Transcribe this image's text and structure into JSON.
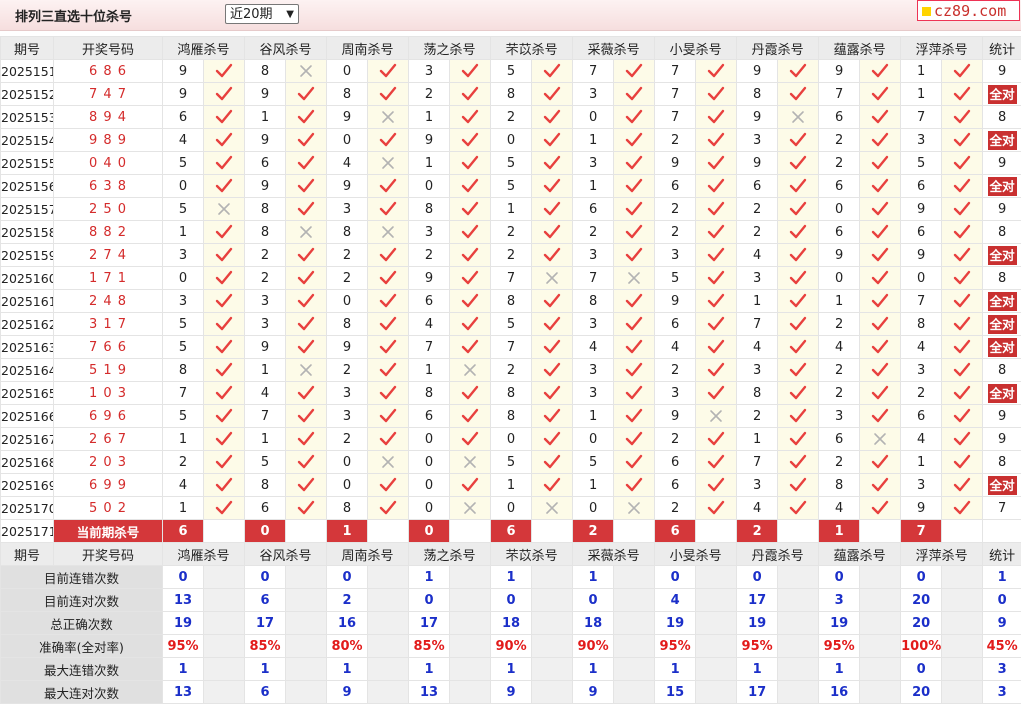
{
  "header": {
    "title": "排列三直选十位杀号",
    "period_select": "近20期",
    "site_logo": "cz89.com"
  },
  "columns": {
    "issue": "期号",
    "win": "开奖号码",
    "experts": [
      "鸿雁杀号",
      "谷风杀号",
      "周南杀号",
      "荡之杀号",
      "芣苡杀号",
      "采薇杀号",
      "小旻杀号",
      "丹霞杀号",
      "蕴露杀号",
      "浮萍杀号"
    ],
    "stat": "统计"
  },
  "rows": [
    {
      "issue": "2025151",
      "win": "6 8 6",
      "k": [
        9,
        8,
        0,
        3,
        5,
        7,
        7,
        9,
        9,
        1
      ],
      "ok": [
        1,
        0,
        1,
        1,
        1,
        1,
        1,
        1,
        1,
        1
      ],
      "stat": "9"
    },
    {
      "issue": "2025152",
      "win": "7 4 7",
      "k": [
        9,
        9,
        8,
        2,
        8,
        3,
        7,
        8,
        7,
        1
      ],
      "ok": [
        1,
        1,
        1,
        1,
        1,
        1,
        1,
        1,
        1,
        1
      ],
      "stat": "全对"
    },
    {
      "issue": "2025153",
      "win": "8 9 4",
      "k": [
        6,
        1,
        9,
        1,
        2,
        0,
        7,
        9,
        6,
        7
      ],
      "ok": [
        1,
        1,
        0,
        1,
        1,
        1,
        1,
        0,
        1,
        1
      ],
      "stat": "8"
    },
    {
      "issue": "2025154",
      "win": "9 8 9",
      "k": [
        4,
        9,
        0,
        9,
        0,
        1,
        2,
        3,
        2,
        3
      ],
      "ok": [
        1,
        1,
        1,
        1,
        1,
        1,
        1,
        1,
        1,
        1
      ],
      "stat": "全对"
    },
    {
      "issue": "2025155",
      "win": "0 4 0",
      "k": [
        5,
        6,
        4,
        1,
        5,
        3,
        9,
        9,
        2,
        5
      ],
      "ok": [
        1,
        1,
        0,
        1,
        1,
        1,
        1,
        1,
        1,
        1
      ],
      "stat": "9"
    },
    {
      "issue": "2025156",
      "win": "6 3 8",
      "k": [
        0,
        9,
        9,
        0,
        5,
        1,
        6,
        6,
        6,
        6
      ],
      "ok": [
        1,
        1,
        1,
        1,
        1,
        1,
        1,
        1,
        1,
        1
      ],
      "stat": "全对"
    },
    {
      "issue": "2025157",
      "win": "2 5 0",
      "k": [
        5,
        8,
        3,
        8,
        1,
        6,
        2,
        2,
        0,
        9
      ],
      "ok": [
        0,
        1,
        1,
        1,
        1,
        1,
        1,
        1,
        1,
        1
      ],
      "stat": "9"
    },
    {
      "issue": "2025158",
      "win": "8 8 2",
      "k": [
        1,
        8,
        8,
        3,
        2,
        2,
        2,
        2,
        6,
        6
      ],
      "ok": [
        1,
        0,
        0,
        1,
        1,
        1,
        1,
        1,
        1,
        1
      ],
      "stat": "8"
    },
    {
      "issue": "2025159",
      "win": "2 7 4",
      "k": [
        3,
        2,
        2,
        2,
        2,
        3,
        3,
        4,
        9,
        9
      ],
      "ok": [
        1,
        1,
        1,
        1,
        1,
        1,
        1,
        1,
        1,
        1
      ],
      "stat": "全对"
    },
    {
      "issue": "2025160",
      "win": "1 7 1",
      "k": [
        0,
        2,
        2,
        9,
        7,
        7,
        5,
        3,
        0,
        0
      ],
      "ok": [
        1,
        1,
        1,
        1,
        0,
        0,
        1,
        1,
        1,
        1
      ],
      "stat": "8"
    },
    {
      "issue": "2025161",
      "win": "2 4 8",
      "k": [
        3,
        3,
        0,
        6,
        8,
        8,
        9,
        1,
        1,
        7
      ],
      "ok": [
        1,
        1,
        1,
        1,
        1,
        1,
        1,
        1,
        1,
        1
      ],
      "stat": "全对"
    },
    {
      "issue": "2025162",
      "win": "3 1 7",
      "k": [
        5,
        3,
        8,
        4,
        5,
        3,
        6,
        7,
        2,
        8
      ],
      "ok": [
        1,
        1,
        1,
        1,
        1,
        1,
        1,
        1,
        1,
        1
      ],
      "stat": "全对"
    },
    {
      "issue": "2025163",
      "win": "7 6 6",
      "k": [
        5,
        9,
        9,
        7,
        7,
        4,
        4,
        4,
        4,
        4
      ],
      "ok": [
        1,
        1,
        1,
        1,
        1,
        1,
        1,
        1,
        1,
        1
      ],
      "stat": "全对"
    },
    {
      "issue": "2025164",
      "win": "5 1 9",
      "k": [
        8,
        1,
        2,
        1,
        2,
        3,
        2,
        3,
        2,
        3
      ],
      "ok": [
        1,
        0,
        1,
        0,
        1,
        1,
        1,
        1,
        1,
        1
      ],
      "stat": "8"
    },
    {
      "issue": "2025165",
      "win": "1 0 3",
      "k": [
        7,
        4,
        3,
        8,
        8,
        3,
        3,
        8,
        2,
        2
      ],
      "ok": [
        1,
        1,
        1,
        1,
        1,
        1,
        1,
        1,
        1,
        1
      ],
      "stat": "全对"
    },
    {
      "issue": "2025166",
      "win": "6 9 6",
      "k": [
        5,
        7,
        3,
        6,
        8,
        1,
        9,
        2,
        3,
        6
      ],
      "ok": [
        1,
        1,
        1,
        1,
        1,
        1,
        0,
        1,
        1,
        1
      ],
      "stat": "9"
    },
    {
      "issue": "2025167",
      "win": "2 6 7",
      "k": [
        1,
        1,
        2,
        0,
        0,
        0,
        2,
        1,
        6,
        4
      ],
      "ok": [
        1,
        1,
        1,
        1,
        1,
        1,
        1,
        1,
        0,
        1
      ],
      "stat": "9"
    },
    {
      "issue": "2025168",
      "win": "2 0 3",
      "k": [
        2,
        5,
        0,
        0,
        5,
        5,
        6,
        7,
        2,
        1
      ],
      "ok": [
        1,
        1,
        0,
        0,
        1,
        1,
        1,
        1,
        1,
        1
      ],
      "stat": "8"
    },
    {
      "issue": "2025169",
      "win": "6 9 9",
      "k": [
        4,
        8,
        0,
        0,
        1,
        1,
        6,
        3,
        8,
        3
      ],
      "ok": [
        1,
        1,
        1,
        1,
        1,
        1,
        1,
        1,
        1,
        1
      ],
      "stat": "全对"
    },
    {
      "issue": "2025170",
      "win": "5 0 2",
      "k": [
        1,
        6,
        8,
        0,
        0,
        0,
        2,
        4,
        4,
        9
      ],
      "ok": [
        1,
        1,
        1,
        0,
        0,
        0,
        1,
        1,
        1,
        1
      ],
      "stat": "7"
    }
  ],
  "current": {
    "issue": "2025171",
    "label": "当前期杀号",
    "k": [
      6,
      0,
      1,
      0,
      6,
      2,
      6,
      2,
      1,
      7
    ]
  },
  "stats": [
    {
      "label": "目前连错次数",
      "v": [
        "0",
        "0",
        "0",
        "1",
        "1",
        "1",
        "0",
        "0",
        "0",
        "0"
      ],
      "stat": "1",
      "red": false
    },
    {
      "label": "目前连对次数",
      "v": [
        "13",
        "6",
        "2",
        "0",
        "0",
        "0",
        "4",
        "17",
        "3",
        "20"
      ],
      "stat": "0",
      "red": false
    },
    {
      "label": "总正确次数",
      "v": [
        "19",
        "17",
        "16",
        "17",
        "18",
        "18",
        "19",
        "19",
        "19",
        "20"
      ],
      "stat": "9",
      "red": false
    },
    {
      "label": "准确率(全对率)",
      "v": [
        "95%",
        "85%",
        "80%",
        "85%",
        "90%",
        "90%",
        "95%",
        "95%",
        "95%",
        "100%"
      ],
      "stat": "45%",
      "red": true
    },
    {
      "label": "最大连错次数",
      "v": [
        "1",
        "1",
        "1",
        "1",
        "1",
        "1",
        "1",
        "1",
        "1",
        "0"
      ],
      "stat": "3",
      "red": false
    },
    {
      "label": "最大连对次数",
      "v": [
        "13",
        "6",
        "9",
        "13",
        "9",
        "9",
        "15",
        "17",
        "16",
        "20"
      ],
      "stat": "3",
      "red": false
    }
  ],
  "colors": {
    "accent_red": "#d4373a",
    "check_red": "#e8403e",
    "cross_gray": "#b3b3b3",
    "stat_blue": "#1b2fc9"
  },
  "icons": {
    "ok": "check-icon",
    "miss": "cross-icon"
  }
}
